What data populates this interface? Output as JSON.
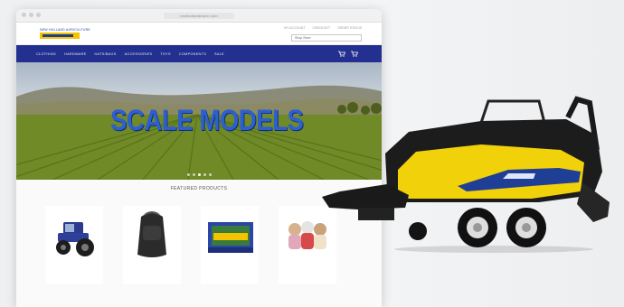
{
  "browser": {
    "url": "newhollandstore.com"
  },
  "site": {
    "logo_text": "NEW HOLLAND AGRICULTURE",
    "top_links": [
      "MY ACCOUNT",
      "CHECKOUT",
      "ORDER STATUS"
    ],
    "search_placeholder": "Shop Store"
  },
  "nav": {
    "items": [
      "CLOTHING",
      "HARDWARE",
      "HATS/BAGS",
      "ACCESSORIES",
      "TOYS",
      "COMPONENTS",
      "SALE"
    ],
    "cart_icons": [
      "cart-icon",
      "cart-icon"
    ]
  },
  "hero": {
    "title": "SCALE MODELS",
    "slides": 5,
    "active_slide": 2
  },
  "featured": {
    "title": "FEATURED PRODUCTS",
    "products": [
      {
        "icon": "tractor-model-icon"
      },
      {
        "icon": "backpack-icon"
      },
      {
        "icon": "boxed-model-icon"
      },
      {
        "icon": "plush-toys-icon"
      }
    ]
  },
  "colors": {
    "brand_blue": "#23308f",
    "brand_yellow": "#f4c400",
    "hero_text": "#2d5fd0"
  },
  "overlay": {
    "icon": "baler-model-icon"
  }
}
